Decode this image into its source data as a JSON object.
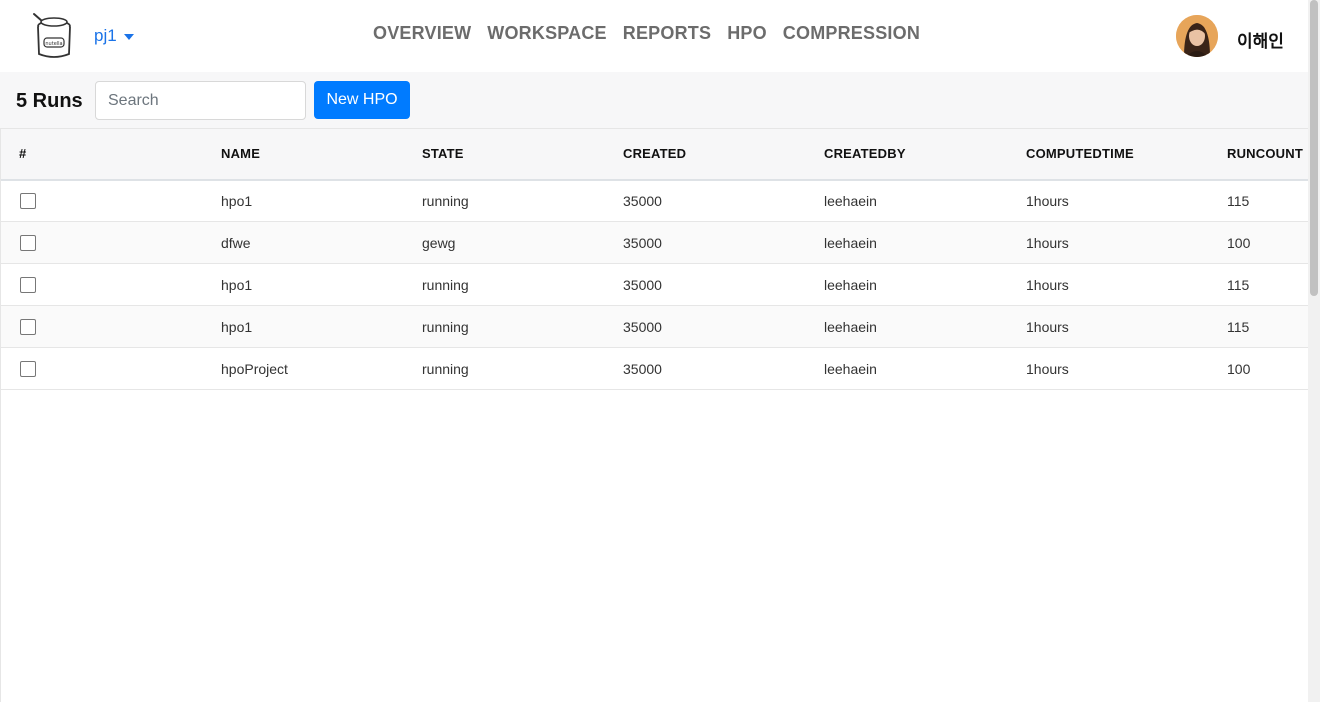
{
  "header": {
    "project": "pj1",
    "nav": [
      "OVERVIEW",
      "WORKSPACE",
      "REPORTS",
      "HPO",
      "COMPRESSION"
    ],
    "user_name": "이해인",
    "logo_icon": "nutella-jar-icon",
    "avatar_icon": "user-avatar"
  },
  "toolbar": {
    "runs_title": "5 Runs",
    "search_placeholder": "Search",
    "new_button": "New HPO"
  },
  "table": {
    "columns": [
      "#",
      "NAME",
      "STATE",
      "CREATED",
      "CREATEDBY",
      "COMPUTEDTIME",
      "RUNCOUNT"
    ],
    "rows": [
      {
        "name": "hpo1",
        "state": "running",
        "created": "35000",
        "createdby": "leehaein",
        "computedtime": "1hours",
        "runcount": "115"
      },
      {
        "name": "dfwe",
        "state": "gewg",
        "created": "35000",
        "createdby": "leehaein",
        "computedtime": "1hours",
        "runcount": "100"
      },
      {
        "name": "hpo1",
        "state": "running",
        "created": "35000",
        "createdby": "leehaein",
        "computedtime": "1hours",
        "runcount": "115"
      },
      {
        "name": "hpo1",
        "state": "running",
        "created": "35000",
        "createdby": "leehaein",
        "computedtime": "1hours",
        "runcount": "115"
      },
      {
        "name": "hpoProject",
        "state": "running",
        "created": "35000",
        "createdby": "leehaein",
        "computedtime": "1hours",
        "runcount": "100"
      }
    ]
  },
  "colors": {
    "accent": "#007bff",
    "project_link": "#1a73e8",
    "nav_text": "#6c6c6c"
  }
}
